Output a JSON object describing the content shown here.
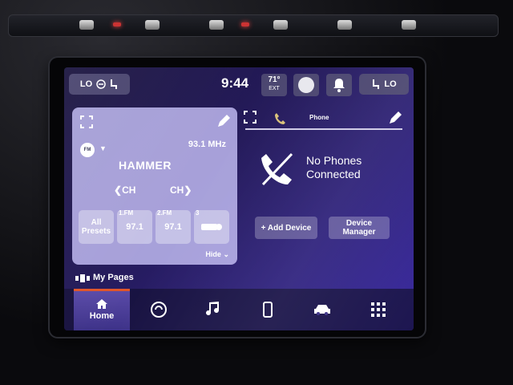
{
  "topbar": {
    "left_seat": "LO",
    "time": "9:44",
    "temp": "71°",
    "temp_sub": "EXT",
    "right_seat": "LO"
  },
  "radio": {
    "band": "FM",
    "frequency": "93.1 MHz",
    "station": "HAMMER",
    "ch_prev": "CH",
    "ch_next": "CH",
    "presets": [
      {
        "index": "",
        "label": "All Presets"
      },
      {
        "index": "1.FM",
        "label": "97.1"
      },
      {
        "index": "2.FM",
        "label": "97.1"
      },
      {
        "index": "3",
        "label": ""
      }
    ],
    "hide_label": "Hide"
  },
  "my_pages": {
    "label": "My Pages"
  },
  "phone": {
    "tab_label": "Phone",
    "status_line1": "No Phones",
    "status_line2": "Connected",
    "add_device": "+ Add Device",
    "device_manager": "Device Manager"
  },
  "nav": {
    "home": "Home",
    "items": [
      "home",
      "apps",
      "media",
      "phone",
      "vehicle",
      "grid"
    ]
  },
  "colors": {
    "accent_active": "#e0552a",
    "screen_bg": "#241a5a",
    "card_bg": "#bebaf0"
  }
}
